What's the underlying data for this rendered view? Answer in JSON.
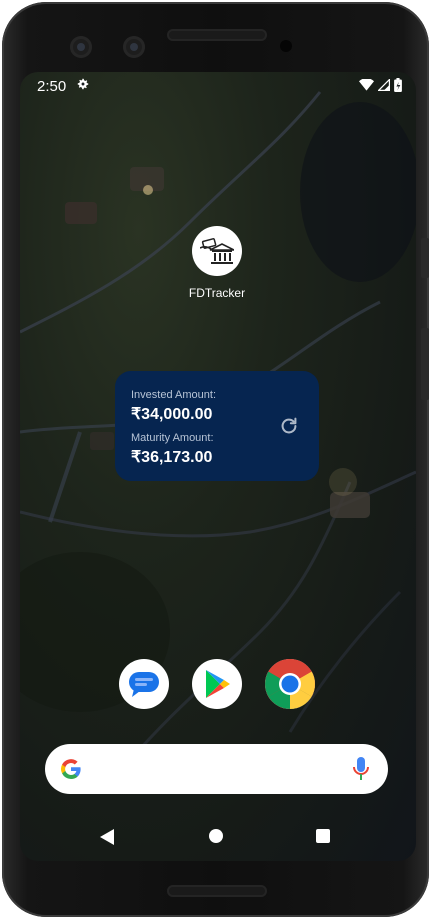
{
  "status_bar": {
    "time": "2:50",
    "icons": [
      "settings-gear-icon",
      "wifi-icon",
      "cell-signal-icon",
      "battery-icon"
    ]
  },
  "home_app": {
    "label": "FDTracker",
    "icon": "bank-money-icon"
  },
  "widget": {
    "invested_label": "Invested Amount:",
    "invested_value": "₹34,000.00",
    "maturity_label": "Maturity Amount:",
    "maturity_value": "₹36,173.00",
    "refresh_icon": "refresh-icon",
    "background": "#062550"
  },
  "dock": {
    "apps": [
      "messages-icon",
      "play-store-icon",
      "chrome-icon"
    ]
  },
  "search": {
    "icons": [
      "google-g-icon",
      "mic-icon"
    ]
  },
  "navigation": {
    "buttons": [
      "back-button",
      "home-button",
      "recents-button"
    ]
  }
}
